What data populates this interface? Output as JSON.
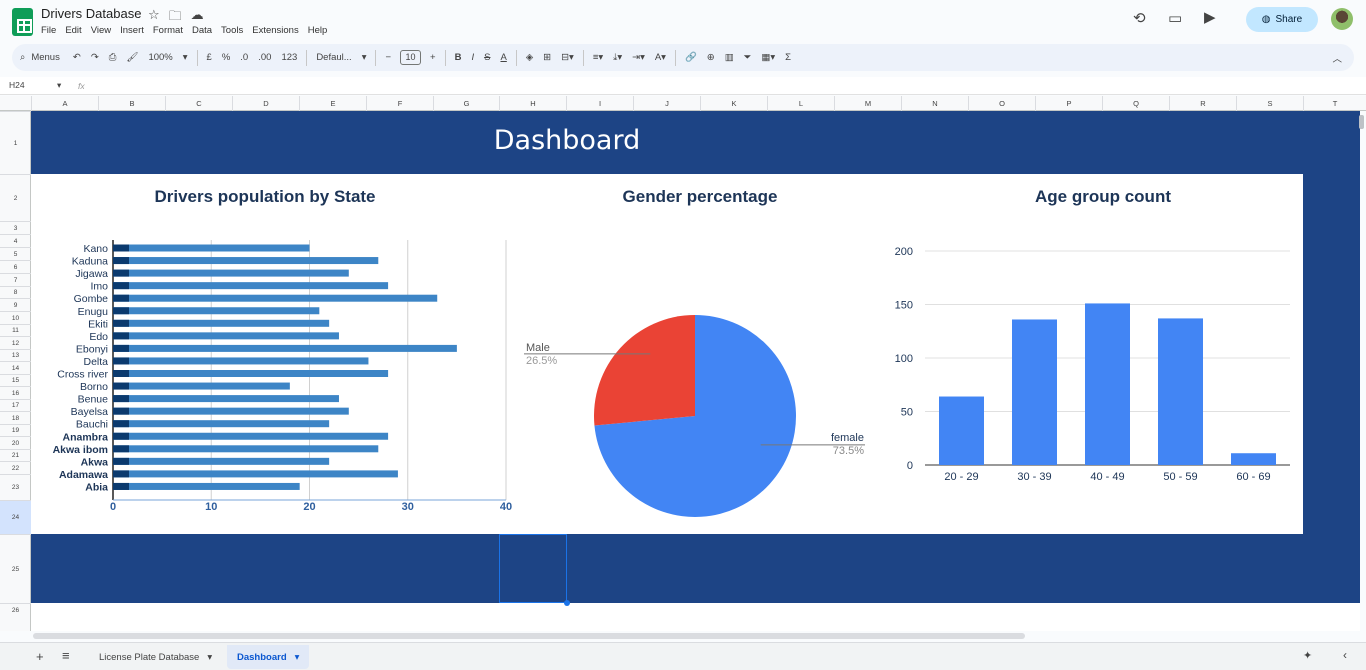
{
  "app": {
    "doc_title": "Drivers Database",
    "menus": [
      "File",
      "Edit",
      "View",
      "Insert",
      "Format",
      "Data",
      "Tools",
      "Extensions",
      "Help"
    ],
    "share_label": "Share"
  },
  "toolbar": {
    "search_label": "Menus",
    "zoom": "100%",
    "currency": "£",
    "percent": "%",
    "dec_dec": ".0",
    "dec_inc": ".00",
    "number_format": "123",
    "font": "Defaul...",
    "font_size": "10",
    "bold": "B",
    "italic": "I",
    "strike": "S",
    "text_color": "A",
    "sigma": "Σ"
  },
  "formula_bar": {
    "cell_ref": "H24",
    "fx": "fx"
  },
  "grid": {
    "columns": [
      "A",
      "B",
      "C",
      "D",
      "E",
      "F",
      "G",
      "H",
      "I",
      "J",
      "K",
      "L",
      "M",
      "N",
      "O",
      "P",
      "Q",
      "R",
      "S",
      "T"
    ],
    "rows": [
      "1",
      "2",
      "3",
      "4",
      "5",
      "6",
      "7",
      "8",
      "9",
      "10",
      "11",
      "12",
      "13",
      "14",
      "15",
      "16",
      "17",
      "18",
      "19",
      "20",
      "21",
      "22",
      "23",
      "24",
      "25",
      "26"
    ]
  },
  "dashboard": {
    "title": "Dashboard"
  },
  "chart_data": [
    {
      "type": "bar",
      "orientation": "horizontal",
      "title": "Drivers population by State",
      "categories": [
        "Kano",
        "Kaduna",
        "Jigawa",
        "Imo",
        "Gombe",
        "Enugu",
        "Ekiti",
        "Edo",
        "Ebonyi",
        "Delta",
        "Cross river",
        "Borno",
        "Benue",
        "Bayelsa",
        "Bauchi",
        "Anambra",
        "Akwa ibom",
        "Akwa",
        "Adamawa",
        "Abia"
      ],
      "bold_categories": [
        "Anambra",
        "Akwa ibom",
        "Akwa",
        "Adamawa",
        "Abia"
      ],
      "values": [
        20,
        27,
        24,
        28,
        33,
        21,
        22,
        23,
        35,
        26,
        28,
        18,
        23,
        24,
        22,
        28,
        27,
        22,
        29,
        19
      ],
      "xlim": [
        0,
        40
      ],
      "xticks": [
        "0",
        "10",
        "20",
        "30",
        "40"
      ],
      "color": "#3d85c6"
    },
    {
      "type": "pie",
      "title": "Gender percentage",
      "slices": [
        {
          "label": "female",
          "percent": "73.5%",
          "value": 73.5,
          "color": "#4285f4"
        },
        {
          "label": "Male",
          "percent": "26.5%",
          "value": 26.5,
          "color": "#ea4335"
        }
      ]
    },
    {
      "type": "bar",
      "title": "Age group count",
      "categories": [
        "20 - 29",
        "30 - 39",
        "40 - 49",
        "50 - 59",
        "60 - 69"
      ],
      "values": [
        64,
        136,
        151,
        137,
        11
      ],
      "ylim": [
        0,
        200
      ],
      "yticks": [
        "0",
        "50",
        "100",
        "150",
        "200"
      ],
      "color": "#4285f4"
    }
  ],
  "sheets": {
    "tabs": [
      {
        "label": "License Plate Database",
        "active": false
      },
      {
        "label": "Dashboard",
        "active": true
      }
    ],
    "add_label": "+",
    "list_label": "≡"
  }
}
